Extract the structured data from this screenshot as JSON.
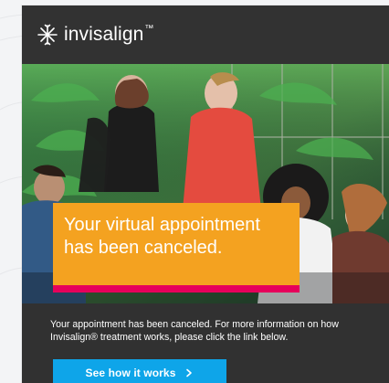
{
  "brand": {
    "name": "invisalign",
    "tm": "™",
    "accent": "#ffffff"
  },
  "hero": {
    "overlay_text": "Your virtual appointment has been canceled.",
    "overlay_bg": "#f4a220",
    "overlay_stripe": "#e6005b"
  },
  "body": {
    "message": "Your appointment has been canceled. For more information on how Invisalign® treatment works, please click the link below."
  },
  "cta": {
    "label": "See how it works",
    "icon": "chevron-right-icon",
    "bg": "#0ea5e9"
  }
}
